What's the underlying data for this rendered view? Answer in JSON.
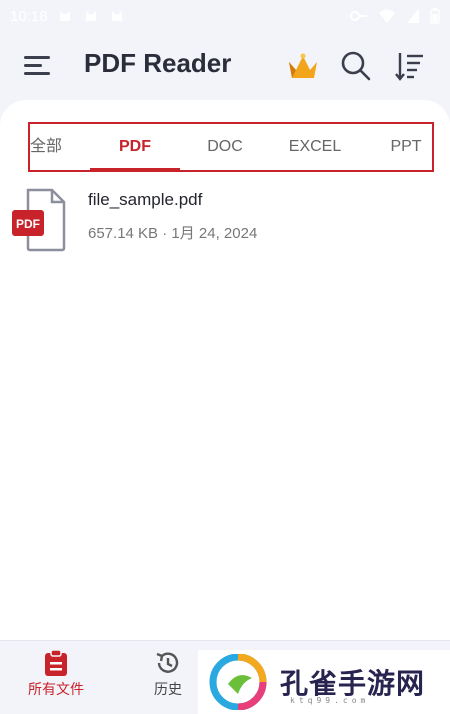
{
  "status_bar": {
    "time": "10:18"
  },
  "app_bar": {
    "title": "PDF Reader"
  },
  "tabs": [
    {
      "label": "全部",
      "active": false
    },
    {
      "label": "PDF",
      "active": true
    },
    {
      "label": "DOC",
      "active": false
    },
    {
      "label": "EXCEL",
      "active": false
    },
    {
      "label": "PPT",
      "active": false
    }
  ],
  "files": [
    {
      "icon_label": "PDF",
      "name": "file_sample.pdf",
      "meta": "657.14 KB · 1月 24, 2024"
    }
  ],
  "bottom_nav": [
    {
      "label": "所有文件",
      "icon": "file-list-icon",
      "active": true
    },
    {
      "label": "历史",
      "icon": "history-icon",
      "active": false
    }
  ],
  "watermark": {
    "text": "孔雀手游网",
    "sub": "ktq99.com"
  },
  "colors": {
    "accent": "#c8232b",
    "title": "#2b2d3a",
    "background": "#f3f4f9"
  }
}
